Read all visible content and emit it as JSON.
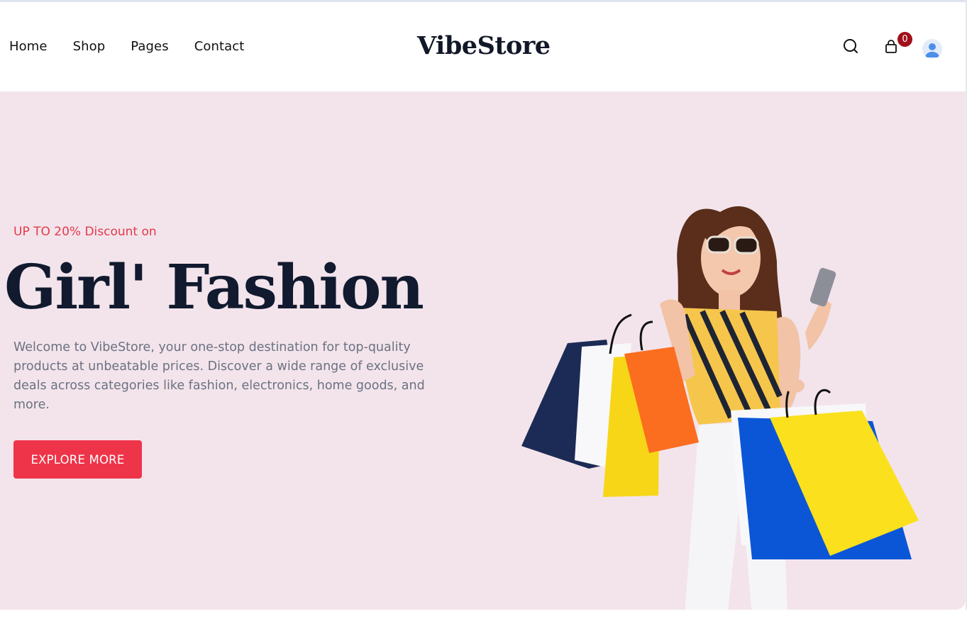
{
  "nav": {
    "items": [
      {
        "label": "Home"
      },
      {
        "label": "Shop"
      },
      {
        "label": "Pages"
      },
      {
        "label": "Contact"
      }
    ]
  },
  "brand": {
    "name": "VibeStore"
  },
  "header_icons": {
    "search": "search-icon",
    "cart": "shopping-bag-icon",
    "cart_count": "0",
    "user": "user-avatar-icon"
  },
  "hero": {
    "eyebrow": "UP TO 20% Discount on",
    "title": "Girl' Fashion",
    "description": "Welcome to VibeStore, your one-stop destination for top-quality products at unbeatable prices. Discover a wide range of exclusive deals across categories like fashion, electronics, home goods, and more.",
    "cta_label": "EXPLORE MORE",
    "image": "woman-with-shopping-bags"
  },
  "colors": {
    "accent": "#ee3449",
    "hero_bg": "#f3e4ec",
    "heading": "#111a2e",
    "badge": "#a0101b"
  }
}
